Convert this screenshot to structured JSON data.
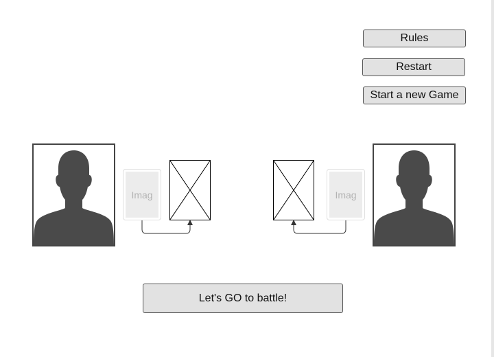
{
  "buttons": {
    "rules": "Rules",
    "restart": "Restart",
    "new_game": "Start a new Game",
    "battle": "Let's GO to battle!"
  },
  "cards": {
    "left_label": "Imag",
    "right_label": "Imag"
  },
  "icons": {
    "avatar": "user-silhouette-icon",
    "placeholder": "image-placeholder-icon",
    "arrow": "arrow-up-icon"
  },
  "colors": {
    "button_bg": "#e2e2e2",
    "silhouette": "#4a4a4a",
    "card_bg": "#ececec"
  }
}
